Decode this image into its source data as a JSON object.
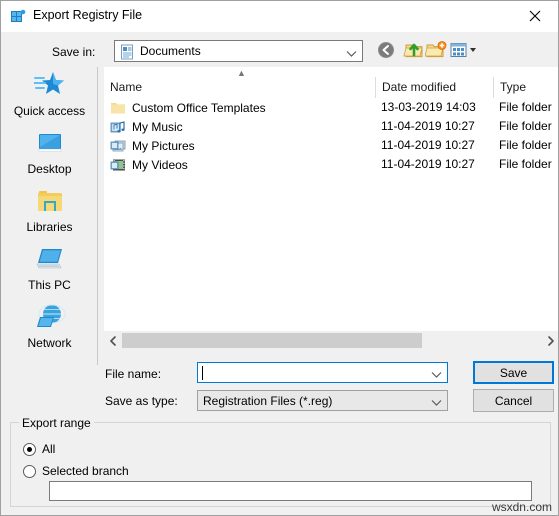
{
  "window": {
    "title": "Export Registry File",
    "title_icon": "registry-grid-icon",
    "close_label": "✕"
  },
  "toolbar": {
    "savein_label": "Save in:",
    "savein_value": "Documents",
    "savein_icon": "document-folder-icon",
    "buttons": [
      {
        "name": "back-button",
        "icon": "back-arrow-icon",
        "enabled": false
      },
      {
        "name": "up-one-level-button",
        "icon": "up-folder-icon",
        "enabled": true
      },
      {
        "name": "new-folder-button",
        "icon": "new-folder-icon",
        "enabled": true
      },
      {
        "name": "views-button",
        "icon": "views-icon",
        "enabled": true
      }
    ]
  },
  "places": {
    "items": [
      {
        "label": "Quick access",
        "icon": "quick-access-star-icon"
      },
      {
        "label": "Desktop",
        "icon": "desktop-monitor-icon"
      },
      {
        "label": "Libraries",
        "icon": "libraries-folder-icon"
      },
      {
        "label": "This PC",
        "icon": "this-pc-icon"
      },
      {
        "label": "Network",
        "icon": "network-globe-icon"
      }
    ]
  },
  "filelist": {
    "sort_column": "Name",
    "sort_direction": "ascending",
    "columns": [
      "Name",
      "Date modified",
      "Type"
    ],
    "rows": [
      {
        "name": "Custom Office Templates",
        "date": "13-03-2019 14:03",
        "type": "File folder",
        "icon": "folder-icon"
      },
      {
        "name": "My Music",
        "date": "11-04-2019 10:27",
        "type": "File folder",
        "icon": "music-folder-icon"
      },
      {
        "name": "My Pictures",
        "date": "11-04-2019 10:27",
        "type": "File folder",
        "icon": "pictures-folder-icon"
      },
      {
        "name": "My Videos",
        "date": "11-04-2019 10:27",
        "type": "File folder",
        "icon": "videos-folder-icon"
      }
    ],
    "scrollbar": {
      "left_arrow": "‹",
      "right_arrow": "›"
    }
  },
  "fields": {
    "filename_label": "File name:",
    "filename_value": "",
    "filename_placeholder": "",
    "savetype_label": "Save as type:",
    "savetype_value": "Registration Files (*.reg)",
    "dropdown_arrow": "⌄"
  },
  "actions": {
    "save_label": "Save",
    "cancel_label": "Cancel"
  },
  "export_range": {
    "group_title": "Export range",
    "options": [
      {
        "label": "All",
        "selected": true
      },
      {
        "label": "Selected branch",
        "selected": false
      }
    ],
    "branch_value": ""
  },
  "watermark": {
    "text": "wsxdn.com"
  },
  "colors": {
    "accent": "#0078d7",
    "window_bg": "#f0f0f0",
    "list_bg": "#ffffff",
    "scrollbar_thumb": "#cdcdcd",
    "button_face": "#e1e1e1"
  }
}
